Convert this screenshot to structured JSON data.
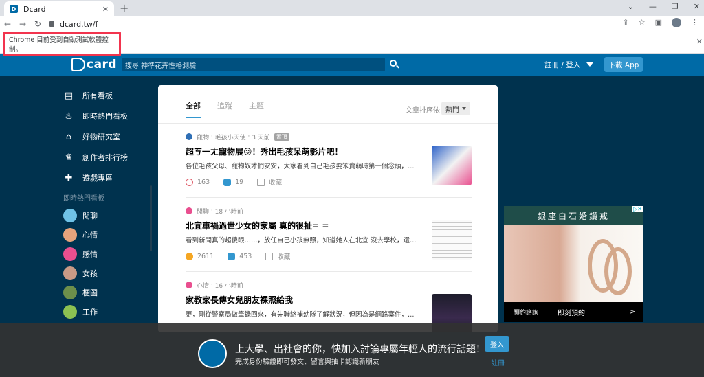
{
  "browser": {
    "tab_title": "Dcard",
    "tab_close": "✕",
    "new_tab": "+",
    "url": "dcard.tw/f",
    "window_buttons": [
      "⌄",
      "—",
      "❐",
      "✕"
    ],
    "automation_notice": "Chrome 目前受到自動測試軟體控制。"
  },
  "header": {
    "logo": "card",
    "search_placeholder": "搜尋 神準花卉性格測驗",
    "login_label": "註冊 / 登入",
    "app_button": "下載 App"
  },
  "sidebar": {
    "items": [
      {
        "label": "所有看板",
        "icon": "▤"
      },
      {
        "label": "即時熱門看板",
        "icon": "♨"
      },
      {
        "label": "好物研究室",
        "icon": "⌂"
      },
      {
        "label": "創作者排行榜",
        "icon": "♛"
      },
      {
        "label": "遊戲專區",
        "icon": "✚"
      }
    ],
    "section_title": "即時熱門看板",
    "boards": [
      {
        "label": "閒聊",
        "color": "#6fc3e8"
      },
      {
        "label": "心情",
        "color": "#e6a37c"
      },
      {
        "label": "感情",
        "color": "#e94f8f"
      },
      {
        "label": "女孩",
        "color": "#c99a86"
      },
      {
        "label": "梗圖",
        "color": "#6d8f4b"
      },
      {
        "label": "工作",
        "color": "#8cc152"
      }
    ]
  },
  "feed": {
    "tabs": [
      "全部",
      "追蹤",
      "主題"
    ],
    "sort_label": "文章排序依",
    "sort_value": "熱門",
    "posts": [
      {
        "board": "寵物",
        "author": "毛孩小天使",
        "time": "3 天前",
        "badge": "置頂",
        "title": "超ㄎ一ㄤ寵物展😜！秀出毛孩呆萌影片吧！",
        "excerpt": "各位毛孩父母、寵物奴才們安安，大家看到自己毛孩耍笨賣萌時第一個念頭，是...",
        "likes": "163",
        "comments": "19",
        "save": "收藏",
        "dot": "#2f6fb5"
      },
      {
        "board": "閒聊",
        "author": "",
        "time": "18 小時前",
        "badge": "",
        "title": "北宜車禍過世少女的家屬 真的很扯= =",
        "excerpt": "看到新聞真的超傻眼……，放任自己小孩無照，知道她人在北宜 沒去學校，還欺...",
        "likes": "2611",
        "comments": "453",
        "save": "收藏",
        "dot": "#e94f8f"
      },
      {
        "board": "心情",
        "author": "",
        "time": "16 小時前",
        "badge": "",
        "title": "家教家長傳女兒朋友裸照給我",
        "excerpt": "更，剛從警察局做筆錄回來，有先聯絡補幼隊了解狀況，但因為是網路案件，員...",
        "likes": "",
        "comments": "",
        "save": "",
        "dot": "#e94f8f"
      }
    ]
  },
  "ad": {
    "title": "銀座白石婚鑽戒",
    "left_text": "預約諮詢",
    "cta": "即刻預約",
    "arrow": ">",
    "mark": "▷✕"
  },
  "overlay": {
    "title": "上大學、出社會的你，快加入討論專屬年輕人的流行話題！",
    "subtitle": "完成身份驗證即可發文、留言與抽卡認識新朋友",
    "login": "登入",
    "register": "註冊"
  }
}
